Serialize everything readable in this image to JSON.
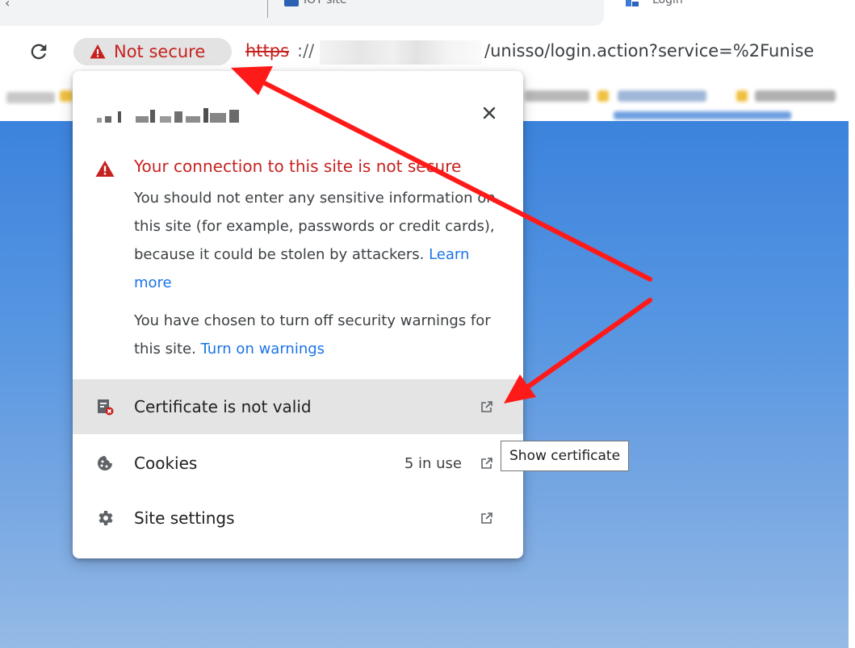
{
  "tabs": [
    {
      "label": "IOT site"
    },
    {
      "label": "Login"
    }
  ],
  "omnibox": {
    "security_chip": "Not secure",
    "url_scheme": "https",
    "url_slashes": "://",
    "url_path": "/unisso/login.action?service=%2Funise"
  },
  "popup": {
    "warning_title": "Your connection to this site is not secure",
    "warning_body": "You should not enter any sensitive information on this site (for example, passwords or credit cards), because it could be stolen by attackers.",
    "learn_more": "Learn more",
    "warnings_off_text": "You have chosen to turn off security warnings for this site.",
    "turn_on_warnings": "Turn on warnings",
    "rows": [
      {
        "label": "Certificate is not valid",
        "icon": "certificate-error-icon"
      },
      {
        "label": "Cookies",
        "value": "5 in use",
        "icon": "cookie-icon"
      },
      {
        "label": "Site settings",
        "icon": "gear-icon"
      }
    ]
  },
  "tooltip": "Show certificate",
  "colors": {
    "insecure_red": "#c5221f",
    "link_blue": "#1a73e8",
    "annotation_red": "#ff1a1a",
    "page_blue": "#4a8de0"
  }
}
